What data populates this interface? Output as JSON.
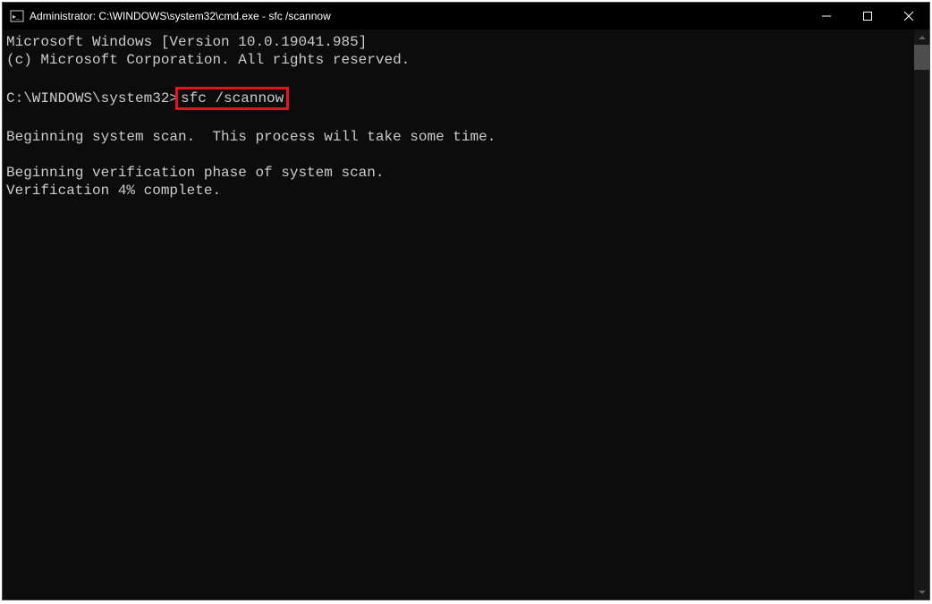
{
  "titlebar": {
    "title": "Administrator: C:\\WINDOWS\\system32\\cmd.exe - sfc  /scannow"
  },
  "terminal": {
    "line1": "Microsoft Windows [Version 10.0.19041.985]",
    "line2": "(c) Microsoft Corporation. All rights reserved.",
    "prompt": "C:\\WINDOWS\\system32>",
    "command": "sfc /scannow",
    "msg1": "Beginning system scan.  This process will take some time.",
    "msg2": "Beginning verification phase of system scan.",
    "msg3": "Verification 4% complete."
  },
  "colors": {
    "highlight": "#e81123",
    "bg": "#0c0c0c",
    "fg": "#cccccc"
  }
}
